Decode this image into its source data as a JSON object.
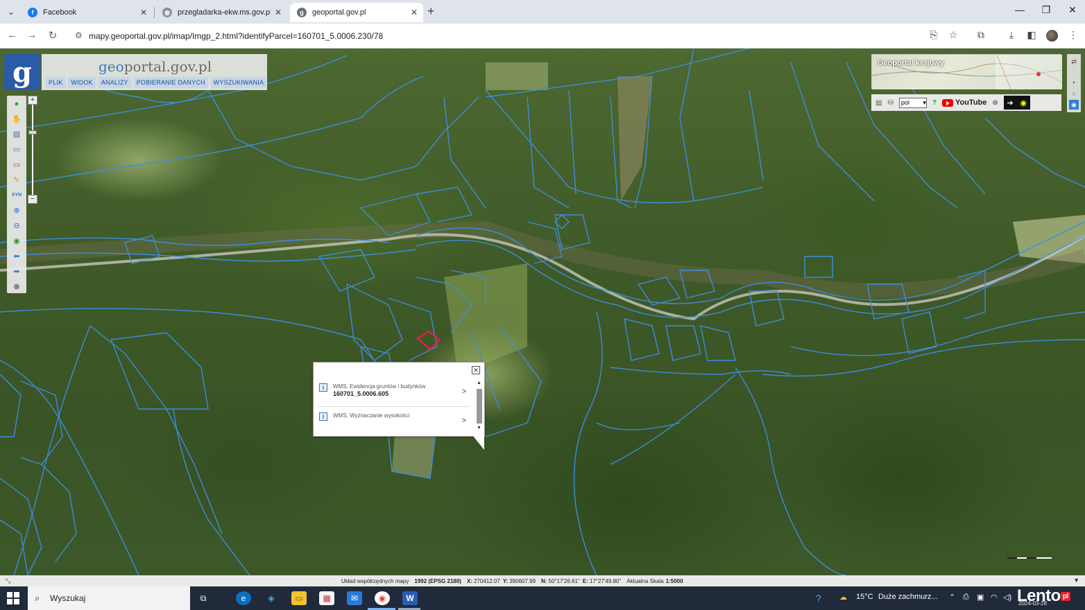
{
  "browser": {
    "tabs": [
      {
        "label": "Facebook",
        "icon": "facebook-icon",
        "active": false
      },
      {
        "label": "przegladarka-ekw.ms.gov.pl/eu",
        "icon": "globe-icon",
        "active": false
      },
      {
        "label": "geoportal.gov.pl",
        "icon": "geoportal-icon",
        "active": true
      }
    ],
    "url": "mapy.geoportal.gov.pl/imap/Imgp_2.html?identifyParcel=160701_5.0006.230/78"
  },
  "geoportal": {
    "logo_letter": "g",
    "title_prefix": "geo",
    "title_rest": "portal.gov.pl",
    "menu": [
      "PLIK",
      "WIDOK",
      "ANALIZY",
      "POBIERANIE DANYCH",
      "WYSZUKIWANIA"
    ],
    "overview_title": "Geoportal krajowy",
    "language": "pol",
    "youtube_label": "YouTube"
  },
  "popup": {
    "rows": [
      {
        "source": "WMS, Ewidencja gruntów i budynków",
        "value": "160701_5.0006.605"
      },
      {
        "source": "WMS, Wyznaczanie wysokości",
        "value": ""
      }
    ]
  },
  "status": {
    "crs_label": "Układ współrzędnych mapy",
    "crs_value": "1992 (EPSG 2180)",
    "x_label": "X:",
    "x_value": "270412.07",
    "y_label": "Y:",
    "y_value": "390607.99",
    "n_label": "N:",
    "n_value": "50°17'26.61\"",
    "e_label": "E:",
    "e_value": "17°27'49.80\"",
    "scale_label": "Aktualna Skala",
    "scale_value": "1:5000"
  },
  "taskbar": {
    "search_placeholder": "Wyszukaj",
    "weather_temp": "15°C",
    "weather_desc": "Duże zachmurz...",
    "date": "2024-03-28",
    "watermark": "Lento",
    "watermark_suffix": "pl"
  },
  "colors": {
    "parcel_lines": "#3d8fe6",
    "selected_parcel": "#e0204a",
    "menu_bg": "#c5d6ea",
    "logo_bg": "#2a5aa8"
  }
}
